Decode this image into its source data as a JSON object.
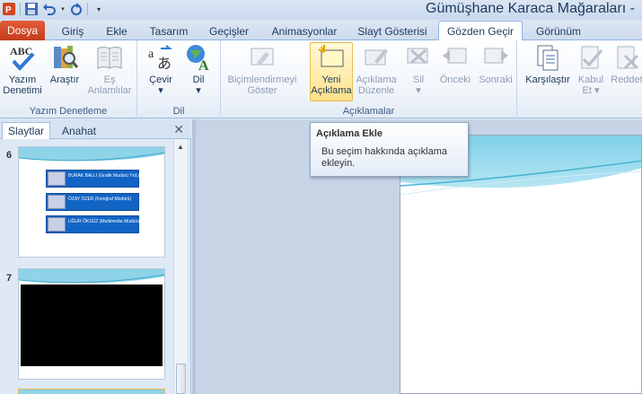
{
  "window": {
    "title": "Gümüşhane Karaca Mağaraları -"
  },
  "qat": {
    "icons": [
      "save-icon",
      "undo-icon",
      "redo-icon"
    ]
  },
  "tabs": [
    {
      "label": "Dosya"
    },
    {
      "label": "Giriş"
    },
    {
      "label": "Ekle"
    },
    {
      "label": "Tasarım"
    },
    {
      "label": "Geçişler"
    },
    {
      "label": "Animasyonlar"
    },
    {
      "label": "Slayt Gösterisi"
    },
    {
      "label": "Gözden Geçir"
    },
    {
      "label": "Görünüm"
    }
  ],
  "ribbon": {
    "groups": {
      "proofing": {
        "label": "Yazım Denetleme",
        "buttons": [
          {
            "label1": "Yazım",
            "label2": "Denetimi"
          },
          {
            "label1": "Araştır",
            "label2": ""
          },
          {
            "label1": "Eş",
            "label2": "Anlamlılar"
          }
        ]
      },
      "language": {
        "label": "Dil",
        "buttons": [
          {
            "label1": "Çevir",
            "label2": "▾"
          },
          {
            "label1": "Dil",
            "label2": "▾"
          }
        ]
      },
      "comments": {
        "label": "Açıklamalar",
        "buttons": [
          {
            "label1": "Biçimlendirmeyi",
            "label2": "Göster"
          },
          {
            "label1": "Yeni",
            "label2": "Açıklama"
          },
          {
            "label1": "Açıklama",
            "label2": "Düzenle"
          },
          {
            "label1": "Sil",
            "label2": "▾"
          },
          {
            "label1": "Önceki",
            "label2": ""
          },
          {
            "label1": "Sonraki",
            "label2": ""
          }
        ]
      },
      "compare": {
        "buttons": [
          {
            "label1": "Karşılaştır",
            "label2": ""
          },
          {
            "label1": "Kabul",
            "label2": "Et ▾"
          },
          {
            "label1": "Reddet",
            "label2": ""
          }
        ]
      }
    }
  },
  "tooltip": {
    "title": "Açıklama Ekle",
    "line1": "Bu seçim hakkında açıklama",
    "line2": "ekleyin."
  },
  "side_pane": {
    "tabs": [
      {
        "label": "Slaytlar"
      },
      {
        "label": "Anahat"
      }
    ],
    "close_icon": "close-icon",
    "slides": [
      {
        "number": "6",
        "items": [
          "BURAK BALLI (Grafik Mudürü Yrd.)",
          "ÖZAY ÖZER (Fotoğraf Müdürü)",
          "UĞUR ÖKSÜZ (Multimedia Müdürü)"
        ]
      },
      {
        "number": "7"
      }
    ]
  },
  "colors": {
    "file_tab": "#c43e1c",
    "accent": "#1164c4",
    "hover": "#ffe28a"
  }
}
